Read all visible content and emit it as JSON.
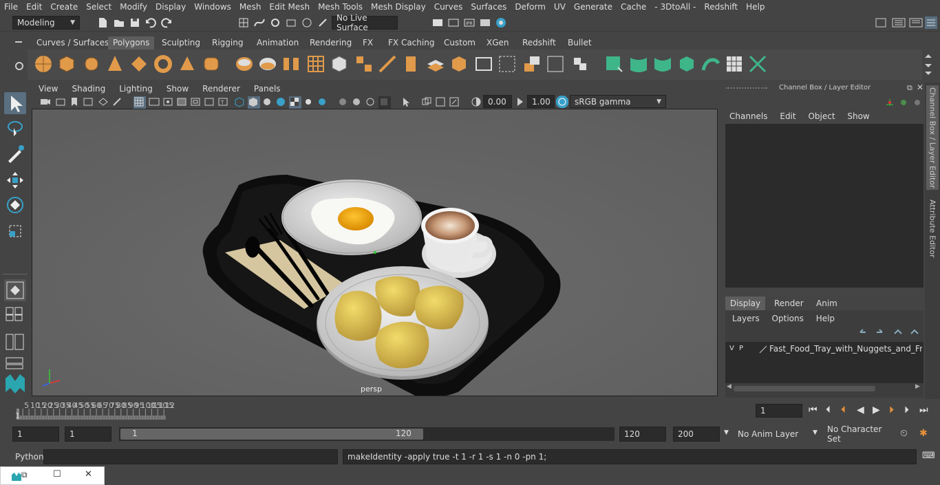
{
  "menu": [
    "File",
    "Edit",
    "Create",
    "Select",
    "Modify",
    "Display",
    "Windows",
    "Mesh",
    "Edit Mesh",
    "Mesh Tools",
    "Mesh Display",
    "Curves",
    "Surfaces",
    "Deform",
    "UV",
    "Generate",
    "Cache",
    "- 3DtoAll -",
    "Redshift",
    "Help"
  ],
  "status": {
    "mode": "Modeling",
    "live_surface": "No Live Surface"
  },
  "shelf_tabs": [
    "Curves / Surfaces",
    "Polygons",
    "Sculpting",
    "Rigging",
    "Animation",
    "Rendering",
    "FX",
    "FX Caching",
    "Custom",
    "XGen",
    "Redshift",
    "Bullet"
  ],
  "shelf_active": "Polygons",
  "viewport": {
    "menu": [
      "View",
      "Shading",
      "Lighting",
      "Show",
      "Renderer",
      "Panels"
    ],
    "near_value": "0.00",
    "far_value": "1.00",
    "color_space": "sRGB gamma",
    "camera_label": "persp"
  },
  "channel_box": {
    "title": "Channel Box / Layer Editor",
    "menu": [
      "Channels",
      "Edit",
      "Object",
      "Show"
    ],
    "layer_tabs": [
      "Display",
      "Render",
      "Anim"
    ],
    "layer_tab_active": "Display",
    "layer_menu": [
      "Layers",
      "Options",
      "Help"
    ],
    "layer": {
      "v": "V",
      "p": "P",
      "name": "Fast_Food_Tray_with_Nuggets_and_Fried_E"
    }
  },
  "side_tabs": [
    "Channel Box / Layer Editor",
    "Attribute Editor"
  ],
  "timeline": {
    "ticks": [
      "5",
      "10",
      "15",
      "20",
      "25",
      "30",
      "35",
      "40",
      "45",
      "50",
      "55",
      "60",
      "65",
      "70",
      "75",
      "80",
      "85",
      "90",
      "95",
      "100",
      "105",
      "110",
      "115",
      "12"
    ],
    "start_label": "1",
    "current_frame": "1"
  },
  "range": {
    "start": "1",
    "playback_start": "1",
    "slider_start": "1",
    "slider_end": "120",
    "playback_end": "120",
    "end": "200",
    "anim_layer": "No Anim Layer",
    "character_set": "No Character Set"
  },
  "cmd": {
    "lang": "Python",
    "output": "makeIdentity -apply true -t 1 -r 1 -s 1 -n 0 -pn 1;"
  }
}
